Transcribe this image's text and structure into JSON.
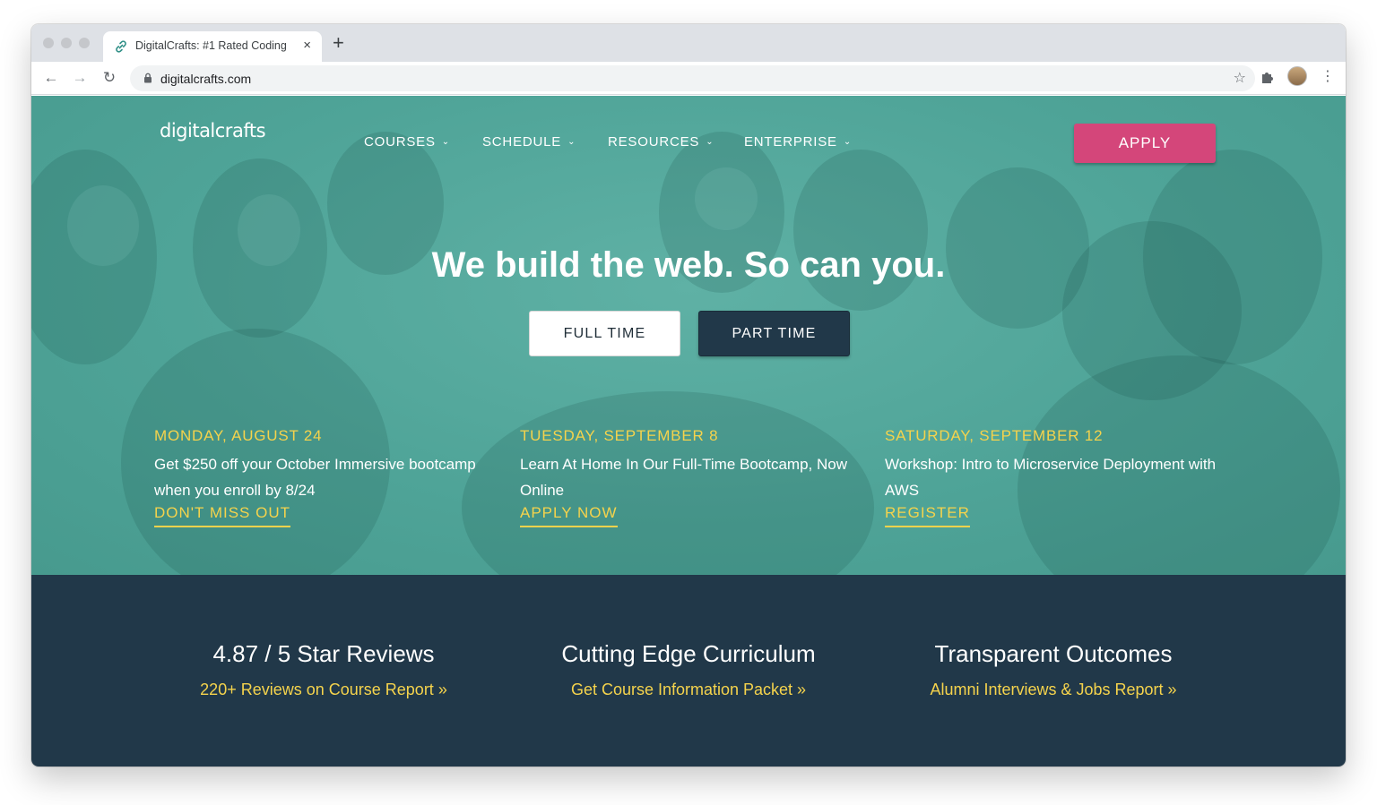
{
  "browser": {
    "tab_title": "DigitalCrafts: #1 Rated Coding",
    "tab_close": "×",
    "new_tab": "+",
    "url": "digitalcrafts.com",
    "back": "←",
    "forward": "→",
    "reload": "↻",
    "star": "☆",
    "menu": "⋮"
  },
  "site": {
    "logo": "digitalcrafts",
    "nav": [
      {
        "label": "COURSES",
        "chevron": "⌄"
      },
      {
        "label": "SCHEDULE",
        "chevron": "⌄"
      },
      {
        "label": "RESOURCES",
        "chevron": "⌄"
      },
      {
        "label": "ENTERPRISE",
        "chevron": "⌄"
      }
    ],
    "apply": "APPLY",
    "headline": "We build the web. So can you.",
    "buttons": {
      "full_time": "FULL TIME",
      "part_time": "PART TIME"
    },
    "events": [
      {
        "date": "MONDAY, AUGUST 24",
        "desc": "Get $250 off your October Immersive bootcamp when you enroll by 8/24",
        "link": "DON'T MISS OUT"
      },
      {
        "date": "TUESDAY, SEPTEMBER 8",
        "desc": "Learn At Home In Our Full-Time Bootcamp, Now Online",
        "link": "APPLY NOW"
      },
      {
        "date": "SATURDAY, SEPTEMBER 12",
        "desc": "Workshop: Intro to Microservice Deployment with AWS",
        "link": "REGISTER"
      }
    ],
    "stats": [
      {
        "heading": "4.87 / 5 Star Reviews",
        "link": "220+ Reviews on Course Report »"
      },
      {
        "heading": "Cutting Edge Curriculum",
        "link": "Get Course Information Packet »"
      },
      {
        "heading": "Transparent Outcomes",
        "link": "Alumni Interviews & Jobs Report »"
      }
    ]
  },
  "colors": {
    "teal": "#4fa498",
    "navy": "#213849",
    "accent_yellow": "#f5d34c",
    "apply_pink": "#d4467a"
  }
}
